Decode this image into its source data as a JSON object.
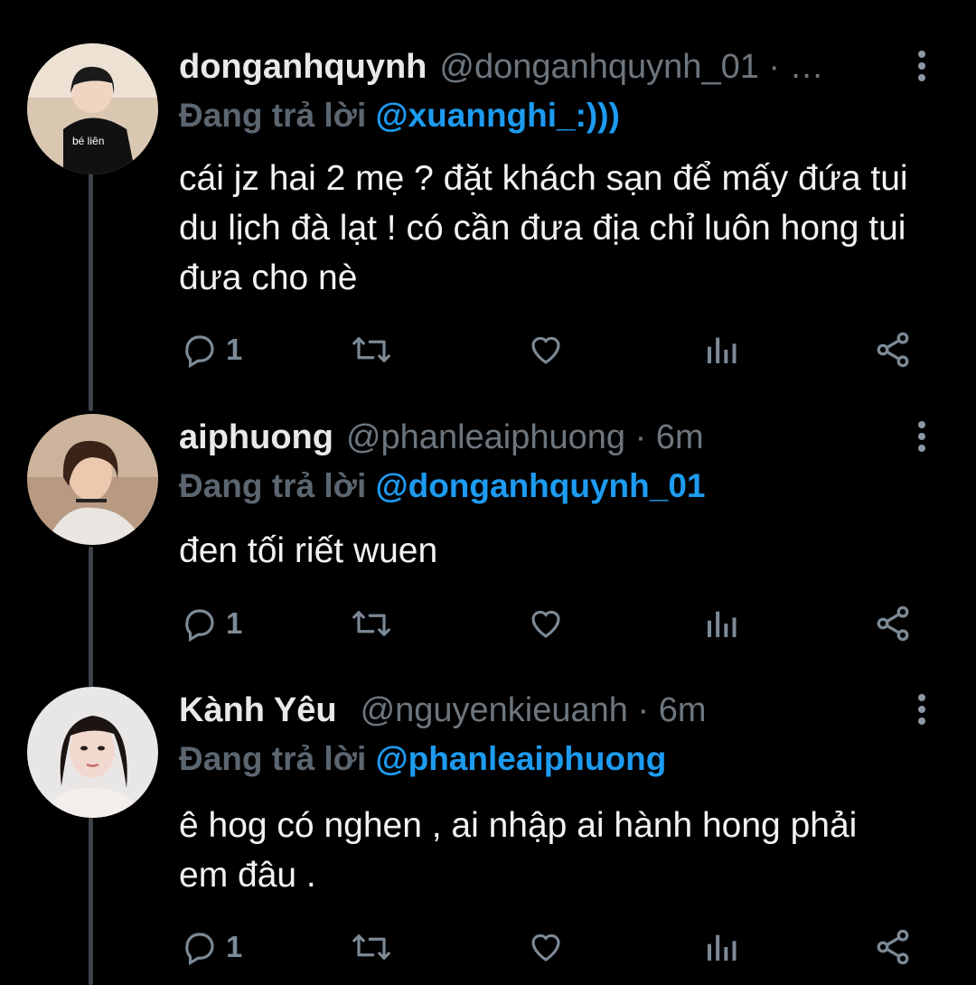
{
  "tweets": [
    {
      "name": "donganhquynh",
      "handle": "@donganhquynh_01 · …",
      "replying_label": "Đang trả lời",
      "replying_to": "@xuannghi_:)))",
      "body": "cái jz hai 2 mẹ ? đặt khách sạn để mấy đứa tui du lịch đà lạt ! có cần đưa địa chỉ luôn hong tui đưa cho nè",
      "avatar_text": "bé liên",
      "reply_count": "1"
    },
    {
      "name": "aiphuong",
      "handle": "@phanleaiphuong · 6m",
      "replying_label": "Đang trả lời",
      "replying_to": "@donganhquynh_01",
      "body": "đen tối riết wuen",
      "reply_count": "1"
    },
    {
      "name": "Kành Yêu",
      "handle": "@nguyenkieuanh · 6m",
      "replying_label": "Đang trả lời",
      "replying_to": "@phanleaiphuong",
      "body": "ê hog có nghen , ai nhập ai hành hong phải em đâu .",
      "reply_count": "1"
    }
  ],
  "icons": {
    "reply": "reply-icon",
    "retweet": "retweet-icon",
    "like": "heart-icon",
    "analytics": "analytics-icon",
    "share": "share-icon",
    "more": "more-vertical-icon"
  },
  "colors": {
    "background": "#000000",
    "mention": "#1d9bf0",
    "muted": "#6e767d",
    "thread_line": "#3d4348"
  }
}
